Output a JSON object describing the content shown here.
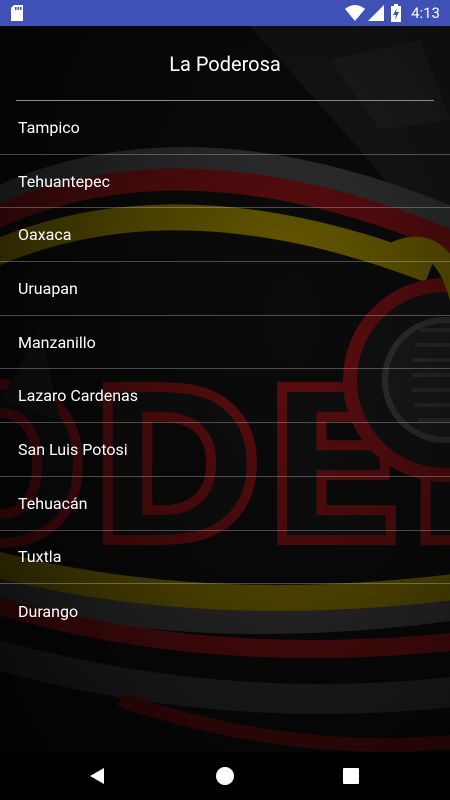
{
  "status_bar": {
    "time": "4:13",
    "icons": [
      "sd-card-icon",
      "wifi-icon",
      "signal-icon",
      "battery-charging-icon"
    ],
    "background_color": "#3f51b5"
  },
  "header": {
    "title": "La Poderosa"
  },
  "cities": [
    {
      "label": "Tampico"
    },
    {
      "label": "Tehuantepec"
    },
    {
      "label": "Oaxaca"
    },
    {
      "label": "Uruapan"
    },
    {
      "label": "Manzanillo"
    },
    {
      "label": "Lazaro Cardenas"
    },
    {
      "label": "San Luis Potosi"
    },
    {
      "label": "Tehuacán"
    },
    {
      "label": "Tuxtla"
    },
    {
      "label": "Durango"
    }
  ],
  "background": {
    "logo_text": "PODEROSA",
    "accent_colors": [
      "#b8141a",
      "#e6c800",
      "#bdbdbd"
    ]
  },
  "nav_bar": {
    "icons": [
      "back-icon",
      "home-icon",
      "recents-icon"
    ]
  }
}
